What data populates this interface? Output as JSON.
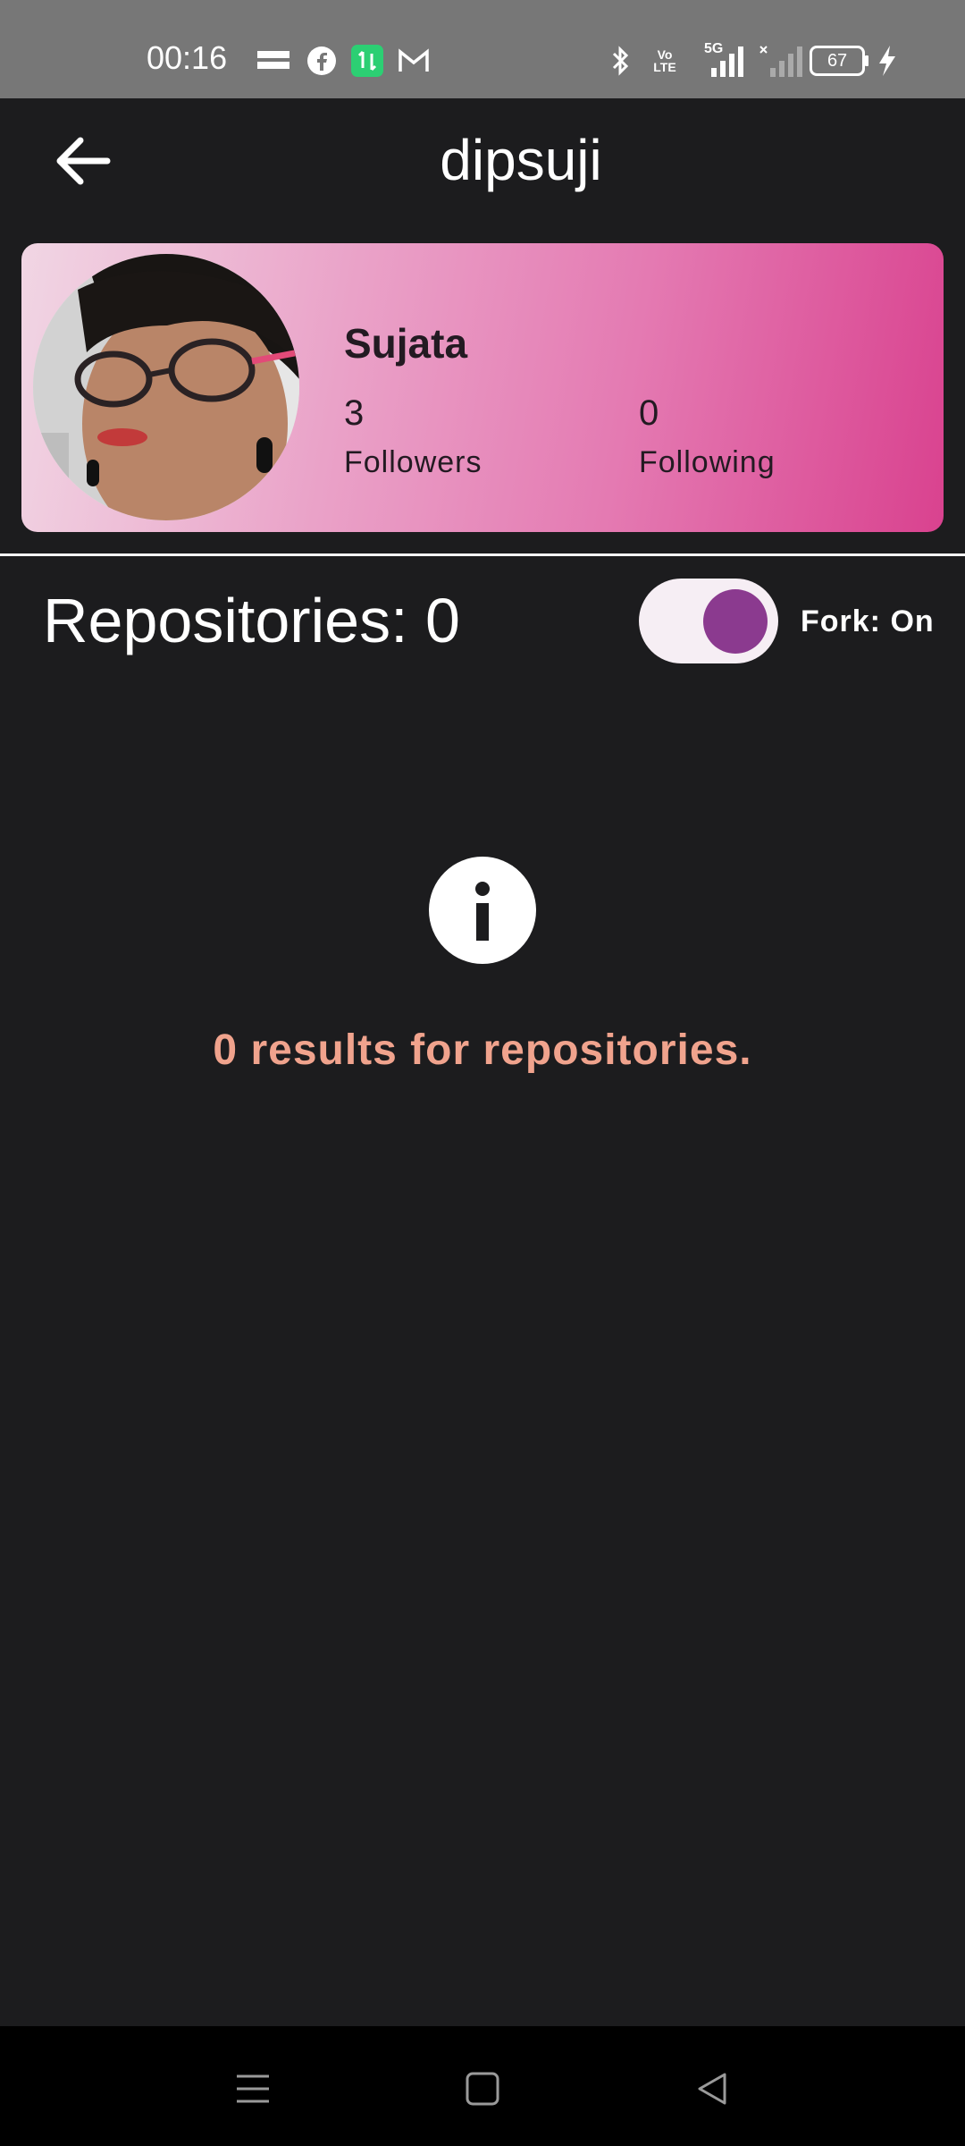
{
  "status_bar": {
    "time": "00:16",
    "left_icons": [
      "temu-icon",
      "facebook-icon",
      "data-transfer-icon",
      "gmail-icon"
    ],
    "right_icons": [
      "bluetooth-icon",
      "volte-icon",
      "signal-5g-icon",
      "signal-no-service-icon",
      "battery-icon",
      "charging-icon"
    ],
    "network_label": "5G",
    "volte_label": "Vo LTE",
    "battery_level": "67"
  },
  "app_bar": {
    "title": "dipsuji",
    "back_icon": "back-arrow-icon"
  },
  "profile": {
    "name": "Sujata",
    "followers_count": "3",
    "followers_label": "Followers",
    "following_count": "0",
    "following_label": "Following",
    "gradient_colors": [
      "#f1d6e4",
      "#d9428f"
    ]
  },
  "repositories": {
    "title": "Repositories: 0",
    "fork_label": "Fork: On",
    "fork_enabled": true,
    "toggle_color": "#8b3a8f"
  },
  "empty_state": {
    "icon": "info-icon",
    "message": "0 results for repositories.",
    "message_color": "#f0a38d"
  },
  "nav_bar": {
    "icons": [
      "menu-icon",
      "home-icon",
      "back-icon"
    ]
  },
  "colors": {
    "background": "#1c1c1e",
    "status_bar": "#777777",
    "nav_bar": "#000000"
  }
}
